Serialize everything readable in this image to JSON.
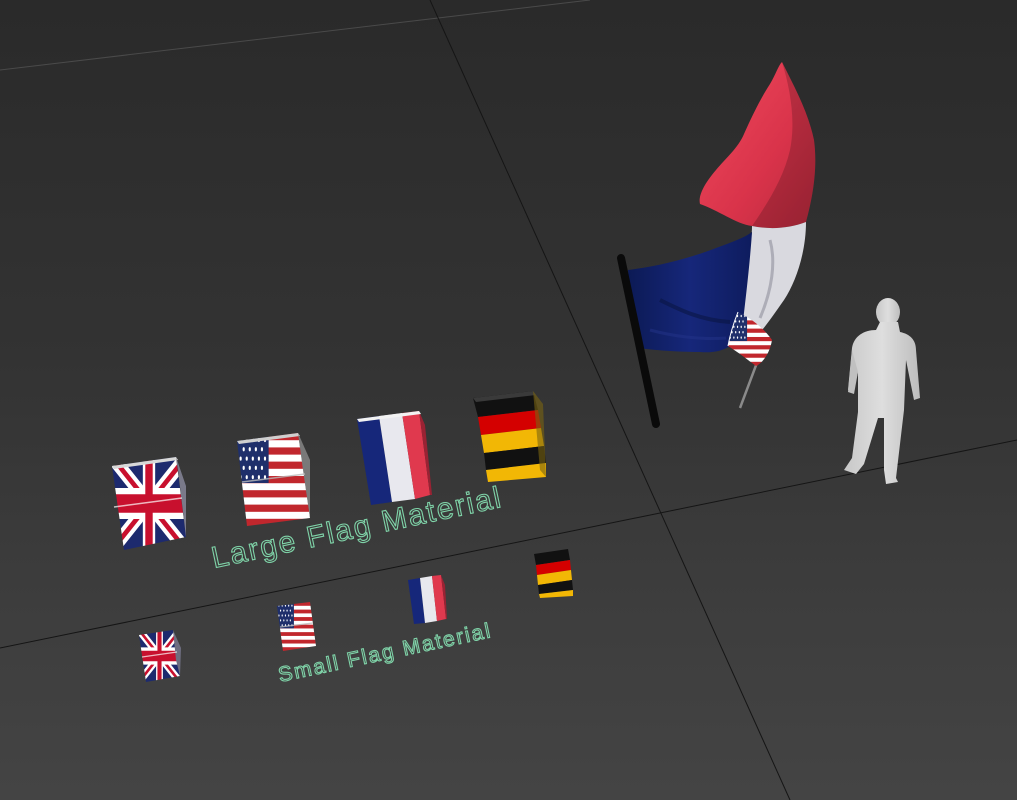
{
  "viewport": {
    "background": "#333333",
    "grid_color": "#0e0e0e",
    "label_color": "#7fd3a8"
  },
  "labels": {
    "large_flag_material": "Large Flag Material",
    "small_flag_material": "Small Flag Material"
  },
  "objects": {
    "large_row": [
      "uk-flag-cube",
      "usa-flag-cube",
      "france-flag-cube",
      "germany-flag-cube"
    ],
    "small_row": [
      "uk-flag-cube",
      "usa-flag-cube",
      "france-flag-cube",
      "germany-flag-cube"
    ],
    "waving_flags": [
      "france-flag",
      "usa-flag"
    ],
    "figure": "human-silhouette"
  },
  "colors": {
    "france_blue": "#0f1e63",
    "france_white": "#e8e8ee",
    "france_red": "#e0394e",
    "usa_red": "#c1272d",
    "usa_blue": "#1f2f6b",
    "uk_blue": "#1d2a6e",
    "uk_red": "#c8102e",
    "germany_black": "#111111",
    "germany_red": "#d40000",
    "germany_gold": "#f2b705",
    "silhouette": "#d4d4d4",
    "pole": "#0a0a0a"
  }
}
